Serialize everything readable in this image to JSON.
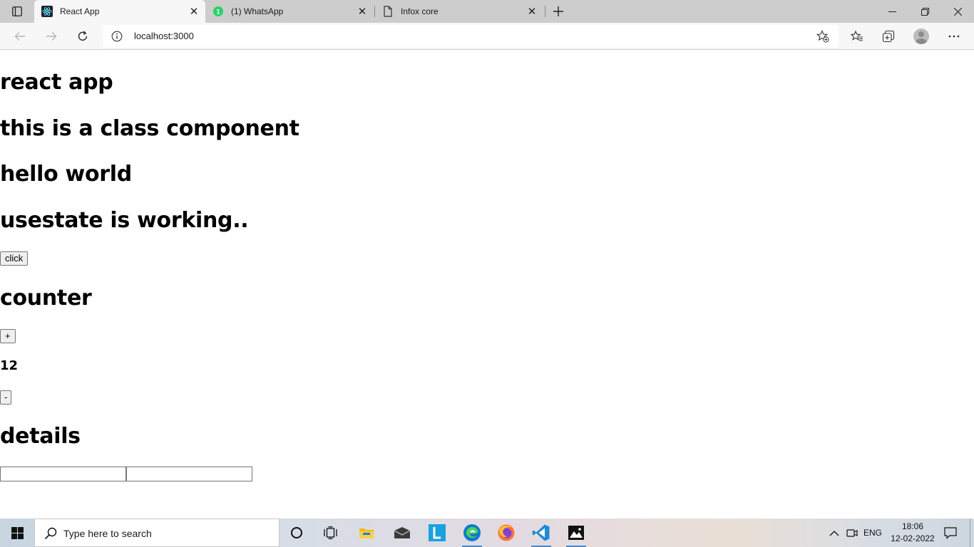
{
  "browser": {
    "tabs": [
      {
        "title": "React App",
        "active": true
      },
      {
        "title": "(1) WhatsApp",
        "badge": "1",
        "active": false
      },
      {
        "title": "Infox core",
        "active": false
      }
    ],
    "address_bar": {
      "url": "localhost:3000"
    }
  },
  "page": {
    "title": "react app",
    "class_component_heading": "this is a class component",
    "hello_heading": "hello world",
    "usestate_heading": "usestate is working..",
    "click_button": "click",
    "counter_heading": "counter",
    "increment_button": "+",
    "count_value": "12",
    "decrement_button": "-",
    "details_heading": "details",
    "inputs": [
      {
        "value": "",
        "placeholder": ""
      },
      {
        "value": "",
        "placeholder": ""
      }
    ]
  },
  "taskbar": {
    "search_placeholder": "Type here to search",
    "pinned_apps": [
      "cortana-icon",
      "task-view-icon",
      "file-explorer-icon",
      "mail-icon",
      "l-app-icon",
      "edge-icon",
      "firefox-icon",
      "vscode-icon",
      "photos-icon"
    ],
    "language": "ENG",
    "time": "18:06",
    "date": "12-02-2022"
  },
  "colors": {
    "tabstrip_bg": "#cdcdcd",
    "whatsapp_green": "#25d366",
    "edge_blue": "#0c7ad1",
    "vscode_blue": "#1f8ad2",
    "l_app_blue": "#1aa1e0"
  }
}
